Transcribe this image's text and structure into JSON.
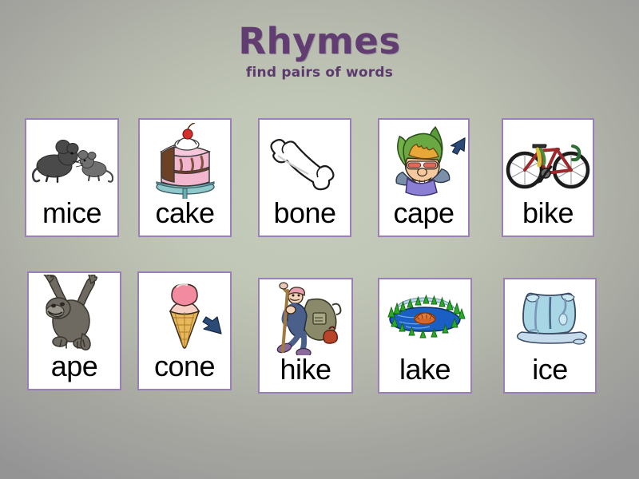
{
  "slide": {
    "title": "Rhymes",
    "subtitle": "find pairs of words",
    "title_color": "#613d72",
    "subtitle_color": "#5d3a6e",
    "background_center_color": "#c6ccbc",
    "background_edge_color": "#949494",
    "card_border_color": "#9b7fb8",
    "card_background_color": "#ffffff"
  },
  "rows": [
    {
      "row_index": 1,
      "cards": [
        {
          "word": "mice",
          "icon": "two-mice-icon",
          "alt": "two gray mice"
        },
        {
          "word": "cake",
          "icon": "layer-cake-icon",
          "alt": "pink layer cake with cherry on a teal cake stand"
        },
        {
          "word": "bone",
          "icon": "bone-icon",
          "alt": "white outlined bone"
        },
        {
          "word": "cape",
          "icon": "superhero-cape-icon",
          "alt": "superhero in green cape with blue arrow pointing at cape"
        },
        {
          "word": "bike",
          "icon": "bicycle-icon",
          "alt": "dark red racing bicycle"
        }
      ]
    },
    {
      "row_index": 2,
      "cards": [
        {
          "word": "ape",
          "icon": "gorilla-ape-icon",
          "alt": "gray gorilla with arms raised"
        },
        {
          "word": "cone",
          "icon": "ice-cream-cone-icon",
          "alt": "ice cream cone with blue arrow pointing at cone"
        },
        {
          "word": "hike",
          "icon": "hiker-icon",
          "alt": "hiker with backpack and walking stick"
        },
        {
          "word": "lake",
          "icon": "lake-icon",
          "alt": "blue lake ringed with green trees"
        },
        {
          "word": "ice",
          "icon": "ice-block-icon",
          "alt": "melting block of ice"
        }
      ]
    }
  ]
}
